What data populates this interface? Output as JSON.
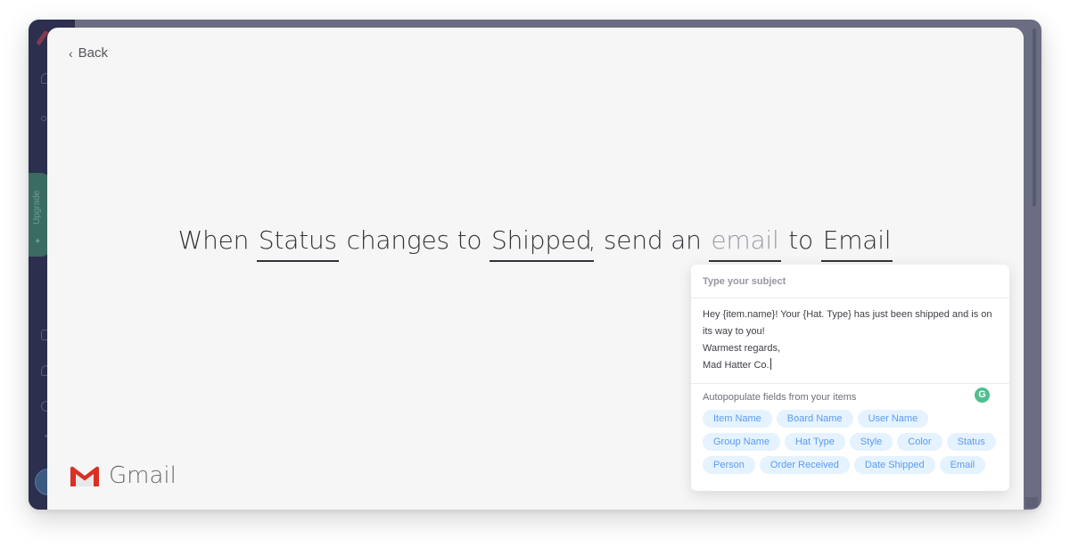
{
  "background_app": {
    "sidebar": {
      "upgrade_label": "Upgrade",
      "icons": [
        "logo-icon",
        "bell-icon",
        "inbox-icon",
        "calendar-icon",
        "people-icon",
        "search-icon",
        "help-icon",
        "avatar"
      ]
    }
  },
  "modal": {
    "back_label": "Back",
    "sentence": {
      "part1": "When",
      "trigger_column": "Status",
      "part2": "changes to",
      "trigger_value": "Shipped",
      "part3": ", send an",
      "action": "email",
      "part4": "to",
      "recipient": "Email"
    },
    "integration": {
      "name": "Gmail",
      "colors": {
        "red": "#d93025",
        "gray": "#dcdcdc"
      }
    }
  },
  "popover": {
    "subject_placeholder": "Type your subject",
    "body_lines": [
      "Hey {item.name}! Your {Hat. Type} has just been shipped and is on its way to you!",
      "Warmest regards,",
      "Mad Hatter Co."
    ],
    "grammarly_glyph": "G",
    "autopopulate_title": "Autopopulate fields from your items",
    "fields": [
      "Item Name",
      "Board Name",
      "User Name",
      "Group Name",
      "Hat Type",
      "Style",
      "Color",
      "Status",
      "Person",
      "Order Received",
      "Date Shipped",
      "Email"
    ],
    "colors": {
      "chip_bg": "#e5f2ff",
      "chip_text": "#5a9cf0",
      "grammarly": "#4fbf8f"
    }
  }
}
